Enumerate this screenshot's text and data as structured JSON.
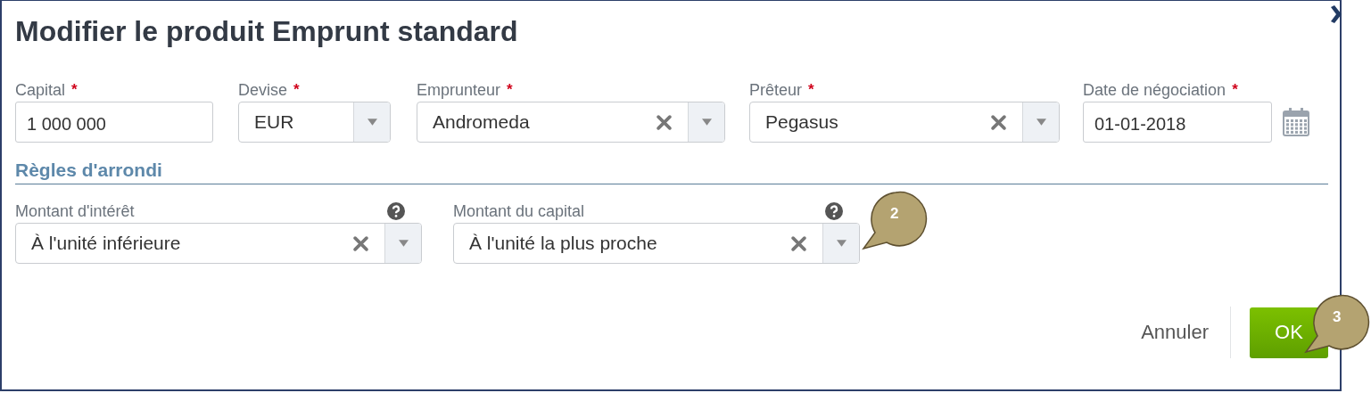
{
  "dialog": {
    "title": "Modifier le produit Emprunt standard"
  },
  "fields": [
    {
      "kind": "text",
      "label": "Capital",
      "required_mark": "*",
      "value": "1 000 000"
    },
    {
      "kind": "select",
      "label": "Devise",
      "required_mark": "*",
      "value": "EUR"
    },
    {
      "kind": "combo",
      "label": "Emprunteur",
      "required_mark": "*",
      "value": "Andromeda"
    },
    {
      "kind": "combo",
      "label": "Prêteur",
      "required_mark": "*",
      "value": "Pegasus"
    },
    {
      "kind": "date",
      "label": "Date de négociation",
      "required_mark": "*",
      "value": "01-01-2018"
    }
  ],
  "section": {
    "title": "Règles d'arrondi",
    "fields": [
      {
        "kind": "combo",
        "label": "Montant d'intérêt",
        "help": true,
        "value": "À l'unité inférieure"
      },
      {
        "kind": "combo",
        "label": "Montant du capital",
        "help": true,
        "value": "À l'unité la plus proche"
      }
    ]
  },
  "footer": {
    "cancel": "Annuler",
    "ok": "OK"
  },
  "callouts": [
    {
      "text": "2"
    },
    {
      "text": "3"
    }
  ]
}
